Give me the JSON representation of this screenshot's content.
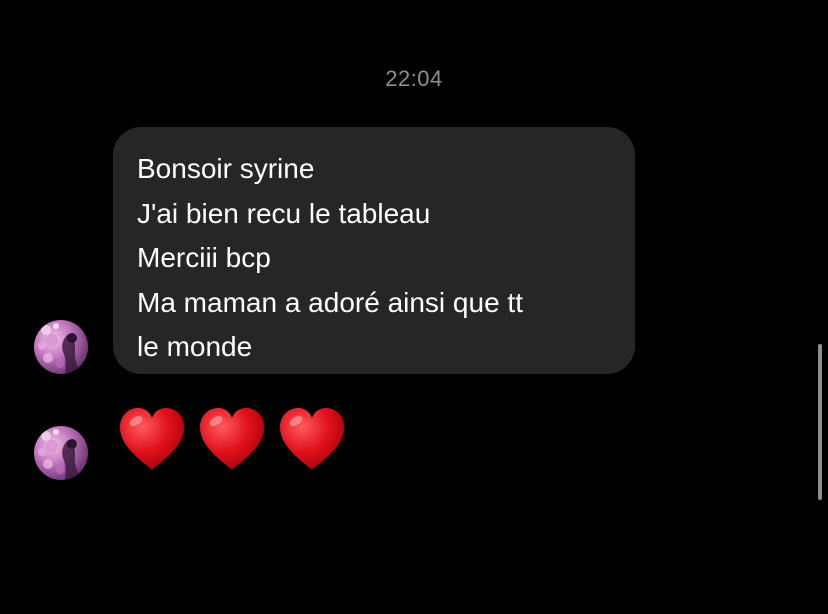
{
  "conversation": {
    "timestamp": "22:04",
    "message": {
      "lines": [
        "Bonsoir syrine",
        "J'ai bien recu le tableau",
        "Merciii bcp",
        "Ma maman a adoré ainsi que tt",
        "le monde"
      ]
    },
    "reaction": {
      "emoji": "❤️❤️❤️",
      "count": 3,
      "icon": "red-heart-icon"
    },
    "avatar_icon": "contact-avatar"
  },
  "colors": {
    "background": "#000000",
    "bubble": "#262628",
    "timestamp": "#8e8e93",
    "heart": "#e0111b"
  }
}
